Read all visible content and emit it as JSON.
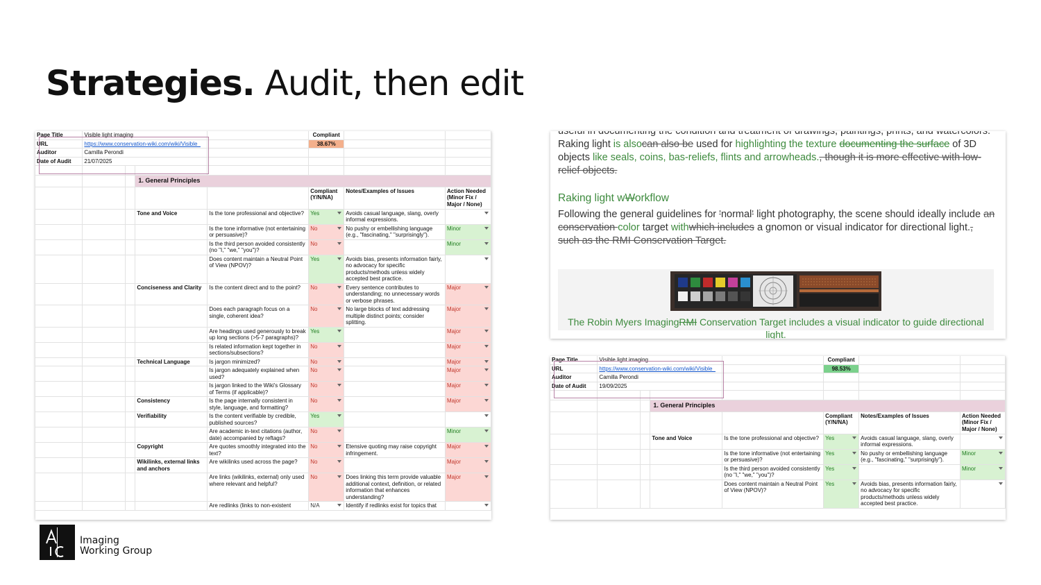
{
  "slide": {
    "title_bold": "Strategies.",
    "title_rest": "Audit, then edit"
  },
  "logo": {
    "icon": "aic-logo-icon",
    "line1": "Imaging",
    "line2": "Working Group"
  },
  "sheet_before": {
    "info": [
      {
        "label": "Page Title",
        "value": "Visible light imaging"
      },
      {
        "label": "URL",
        "value": "https://www.conservation-wiki.com/wiki/Visible_"
      },
      {
        "label": "Auditor",
        "value": "Camilla Perondi"
      },
      {
        "label": "Date of Audit",
        "value": "21/07/2025"
      }
    ],
    "compliant_label": "Compliant",
    "compliant_value": "38.67%",
    "section_title": "1. General Principles",
    "headers": {
      "compliant": "Compliant (Y/N/NA)",
      "notes": "Notes/Examples of Issues",
      "action": "Action Needed (Minor Fix / Major / None)"
    },
    "rows": [
      {
        "cat": "Tone and Voice",
        "q": "Is the tone professional and objective?",
        "c": "Yes",
        "n": "Avoids casual language, slang, overly informal expressions.",
        "a": ""
      },
      {
        "cat": "",
        "q": "Is the tone informative (not entertaining or persuasive)?",
        "c": "No",
        "n": "No pushy or embellishing language (e.g., \"fascinating,\" \"surprisingly\").",
        "a": "Minor"
      },
      {
        "cat": "",
        "q": "Is the third person avoided consistently (no \"I,\" \"we,\" \"you\")?",
        "c": "No",
        "n": "",
        "a": "Minor"
      },
      {
        "cat": "",
        "q": "Does content maintain a Neutral Point of View (NPOV)?",
        "c": "Yes",
        "n": "Avoids bias, presents information fairly, no advocacy for specific products/methods unless widely accepted best practice.",
        "a": ""
      },
      {
        "cat": "Conciseness and Clarity",
        "q": "Is the content direct and to the point?",
        "c": "No",
        "n": "Every sentence contributes to understanding; no unnecessary words or verbose phrases.",
        "a": "Major"
      },
      {
        "cat": "",
        "q": "Does each paragraph focus on a single, coherent idea?",
        "c": "No",
        "n": "No large blocks of text addressing multiple distinct points; consider splitting.",
        "a": "Major"
      },
      {
        "cat": "",
        "q": "Are headings used generously to break up long sections (>5-7 paragraphs)?",
        "c": "Yes",
        "n": "",
        "a": "Major"
      },
      {
        "cat": "",
        "q": "Is related information kept together in sections/subsections?",
        "c": "No",
        "n": "",
        "a": "Major"
      },
      {
        "cat": "Technical Language",
        "q": "Is jargon minimized?",
        "c": "No",
        "n": "",
        "a": "Major"
      },
      {
        "cat": "",
        "q": "Is jargon adequately explained when used?",
        "c": "No",
        "n": "",
        "a": "Major"
      },
      {
        "cat": "",
        "q": "Is jargon linked to the Wiki's Glossary of Terms (if applicable)?",
        "c": "No",
        "n": "",
        "a": "Major"
      },
      {
        "cat": "Consistency",
        "q": "Is the page internally consistent in style, language, and formatting?",
        "c": "No",
        "n": "",
        "a": "Major"
      },
      {
        "cat": "Verifiability",
        "q": "Is the content verifiable by credible, published sources?",
        "c": "Yes",
        "n": "",
        "a": ""
      },
      {
        "cat": "",
        "q": "Are academic in-text citations (author, date) accompanied by reftags?",
        "c": "No",
        "n": "",
        "a": "Minor"
      },
      {
        "cat": "Copyright",
        "q": "Are quotes smoothly integrated into the text?",
        "c": "No",
        "n": "Etensive quoting may raise copyright infringement.",
        "a": "Major"
      },
      {
        "cat": "Wikilinks, external links and anchors",
        "q": "Are wikilinks used across the page?",
        "c": "No",
        "n": "",
        "a": "Major"
      },
      {
        "cat": "",
        "q": "Are links (wikilinks, external) only used where relevant and helpful?",
        "c": "No",
        "n": "Does linking this term provide valuable additional context, definition, or related information that enhances understanding?",
        "a": "Major"
      },
      {
        "cat": "",
        "q": "Are redlinks (links to non-existent",
        "c": "N/A",
        "n": "Identify if redlinks exist for topics that",
        "a": ""
      }
    ]
  },
  "sheet_after": {
    "info": [
      {
        "label": "Page Title",
        "value": "Visible light imaging"
      },
      {
        "label": "URL",
        "value": "https://www.conservation-wiki.com/wiki/Visible_"
      },
      {
        "label": "Auditor",
        "value": "Camilla Perondi"
      },
      {
        "label": "Date of Audit",
        "value": "19/09/2025"
      }
    ],
    "compliant_label": "Compliant",
    "compliant_value": "98.53%",
    "section_title": "1. General Principles",
    "headers": {
      "compliant": "Compliant (Y/N/NA)",
      "notes": "Notes/Examples of Issues",
      "action": "Action Needed (Minor Fix / Major / None)"
    },
    "rows": [
      {
        "cat": "Tone and Voice",
        "q": "Is the tone professional and objective?",
        "c": "Yes",
        "n": "Avoids casual language, slang, overly informal expressions.",
        "a": ""
      },
      {
        "cat": "",
        "q": "Is the tone informative (not entertaining or persuasive)?",
        "c": "Yes",
        "n": "No pushy or embellishing language (e.g., \"fascinating,\" \"surprisingly\").",
        "a": "Minor"
      },
      {
        "cat": "",
        "q": "Is the third person avoided consistently (no \"I,\" \"we,\" \"you\")?",
        "c": "Yes",
        "n": "",
        "a": "Minor"
      },
      {
        "cat": "",
        "q": "Does content maintain a Neutral Point of View (NPOV)?",
        "c": "Yes",
        "n": "Avoids bias, presents information fairly, no advocacy for specific products/methods unless widely accepted best practice.",
        "a": ""
      }
    ]
  },
  "doc": {
    "p1": {
      "l0": "useful in documenting the condition and treatment of drawings, paintings, prints, and watercolors.",
      "s1": "Raking light ",
      "ins1": "is also",
      "del1": "can also be",
      "s2": " used for ",
      "ins2": "highlighting the texture",
      "s3": " ",
      "del2": "documenting the surface",
      "s4": " of 3D objects ",
      "ins3": "like seals, coins, bas-reliefs, flints and arrowheads.",
      "del3": ", though it is more effective with low-relief objects."
    },
    "heading": {
      "a": "Raking light w",
      "del": "W",
      "b": "orkflow"
    },
    "p2": {
      "s1": "Following the general guidelines for ",
      "del1": "'",
      "s2": "normal",
      "del2": "'",
      "s3": " light photography, the scene should ideally include ",
      "del3": "an conservation ",
      "ins1": "color",
      "s4": " target ",
      "ins2": "with",
      "del4": "which includes",
      "s5": " a gnomon or visual indicator for directional light.",
      "del5": ", such as the RMI Conservation Target."
    },
    "caption": {
      "a": "The Robin Myers Imaging",
      "del": "RMI",
      "b": " Conservation Target includes a visual indicator to guide directional light."
    },
    "colors": {
      "inserted": "#3d8a3d",
      "section": "#ead1dc",
      "yes": "#d8f2d2",
      "no": "#fcd7d4"
    }
  }
}
